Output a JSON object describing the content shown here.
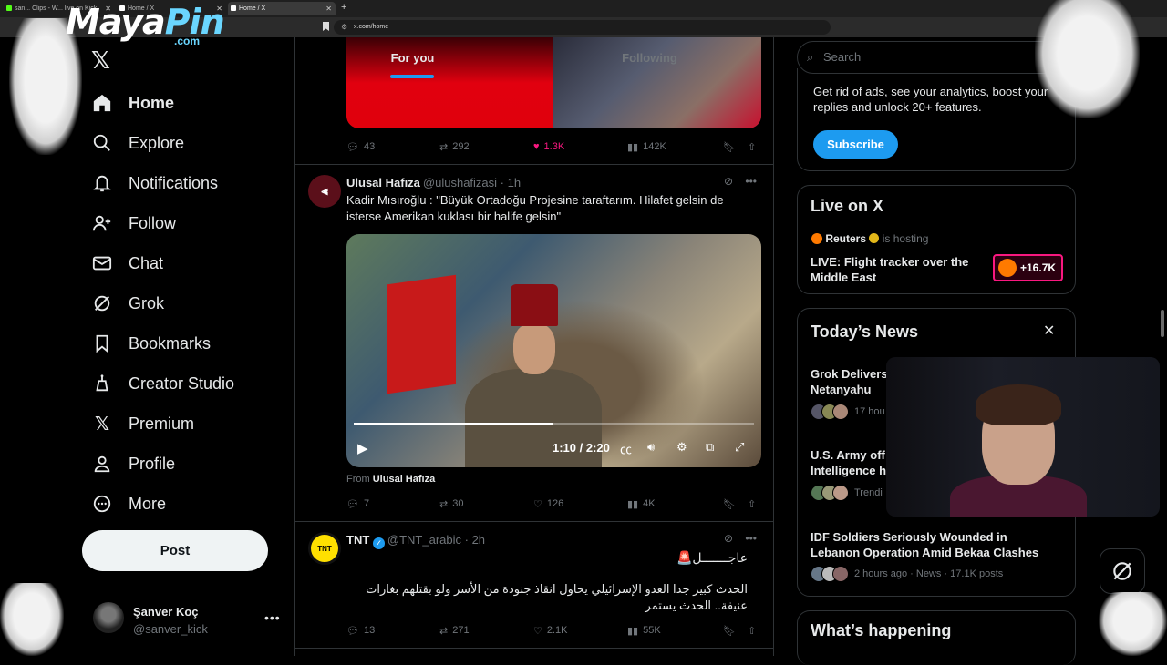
{
  "browser": {
    "tabs": [
      {
        "label": "san... Clips - W... live on Kick",
        "active": false
      },
      {
        "label": "Home / X",
        "active": false
      },
      {
        "label": "Home / X",
        "active": true
      }
    ],
    "new_tab": "+",
    "url": "x.com/home"
  },
  "watermark": {
    "maya": "Maya",
    "pin": "Pin",
    "com": ".com"
  },
  "nav": {
    "items": [
      {
        "label": "Home",
        "icon": "home-icon"
      },
      {
        "label": "Explore",
        "icon": "search-icon"
      },
      {
        "label": "Notifications",
        "icon": "bell-icon"
      },
      {
        "label": "Follow",
        "icon": "person-add-icon"
      },
      {
        "label": "Chat",
        "icon": "mail-icon"
      },
      {
        "label": "Grok",
        "icon": "grok-icon"
      },
      {
        "label": "Bookmarks",
        "icon": "bookmark-icon"
      },
      {
        "label": "Creator Studio",
        "icon": "creator-icon"
      },
      {
        "label": "Premium",
        "icon": "x-icon"
      },
      {
        "label": "Profile",
        "icon": "profile-icon"
      },
      {
        "label": "More",
        "icon": "more-circle-icon"
      }
    ],
    "post_label": "Post",
    "profile": {
      "name": "Şanver Koç",
      "handle": "@sanver_kick"
    }
  },
  "feed": {
    "tabs": {
      "for_you": "For you",
      "following": "Following"
    },
    "prev_actions": {
      "replies": "43",
      "reposts": "292",
      "likes": "1.3K",
      "views": "142K"
    },
    "tweet1": {
      "name": "Ulusal Hafıza",
      "handle": "@ulushafizasi · 1h",
      "text": "Kadir Mısıroğlu : \"Büyük Ortadoğu Projesine taraftarım. Hilafet gelsin de isterse Amerikan kuklası bir halife gelsin\"",
      "video_time": "1:10 / 2:20",
      "from_prefix": "From",
      "from_name": "Ulusal Hafıza",
      "actions": {
        "replies": "7",
        "reposts": "30",
        "likes": "126",
        "views": "4K"
      }
    },
    "tweet2": {
      "name": "TNT",
      "handle": "@TNT_arabic · 2h",
      "avatar_label": "TNT",
      "headline": "عاجـــــــل🚨",
      "text": "الحدث كبير جدا العدو الإسرائيلي يحاول انقاذ جنودة من الأسر ولو بقتلهم بغارات عنيفة.. الحدث يستمر",
      "actions": {
        "replies": "13",
        "reposts": "271",
        "likes": "2.1K",
        "views": "55K"
      }
    }
  },
  "right": {
    "search_placeholder": "Search",
    "premium_text": "Get rid of ads, see your analytics, boost your replies and unlock 20+ features.",
    "subscribe": "Subscribe",
    "live": {
      "title": "Live on X",
      "host": "Reuters",
      "hosting": "is hosting",
      "event": "LIVE: Flight tracker over the Middle East",
      "count": "+16.7K"
    },
    "news": {
      "title": "Today’s News",
      "items": [
        {
          "headline": "Grok Delivers ... Netanyahu",
          "line1": "Grok Delivers",
          "line2": "Netanyahu",
          "meta": "17 hou"
        },
        {
          "headline": "U.S. Army of... Intelligence h",
          "line1": "U.S. Army off",
          "line2": "Intelligence h",
          "meta": "Trendi"
        },
        {
          "headline": "IDF Soldiers Seriously Wounded in Lebanon Operation Amid Bekaa Clashes",
          "meta": "2 hours ago · News · 17.1K posts"
        }
      ]
    },
    "happening_title": "What’s happening"
  },
  "colors": {
    "accent": "#1d9bf0",
    "like": "#f91880",
    "bg": "#000000",
    "border": "#2f3336",
    "muted": "#71767b"
  }
}
